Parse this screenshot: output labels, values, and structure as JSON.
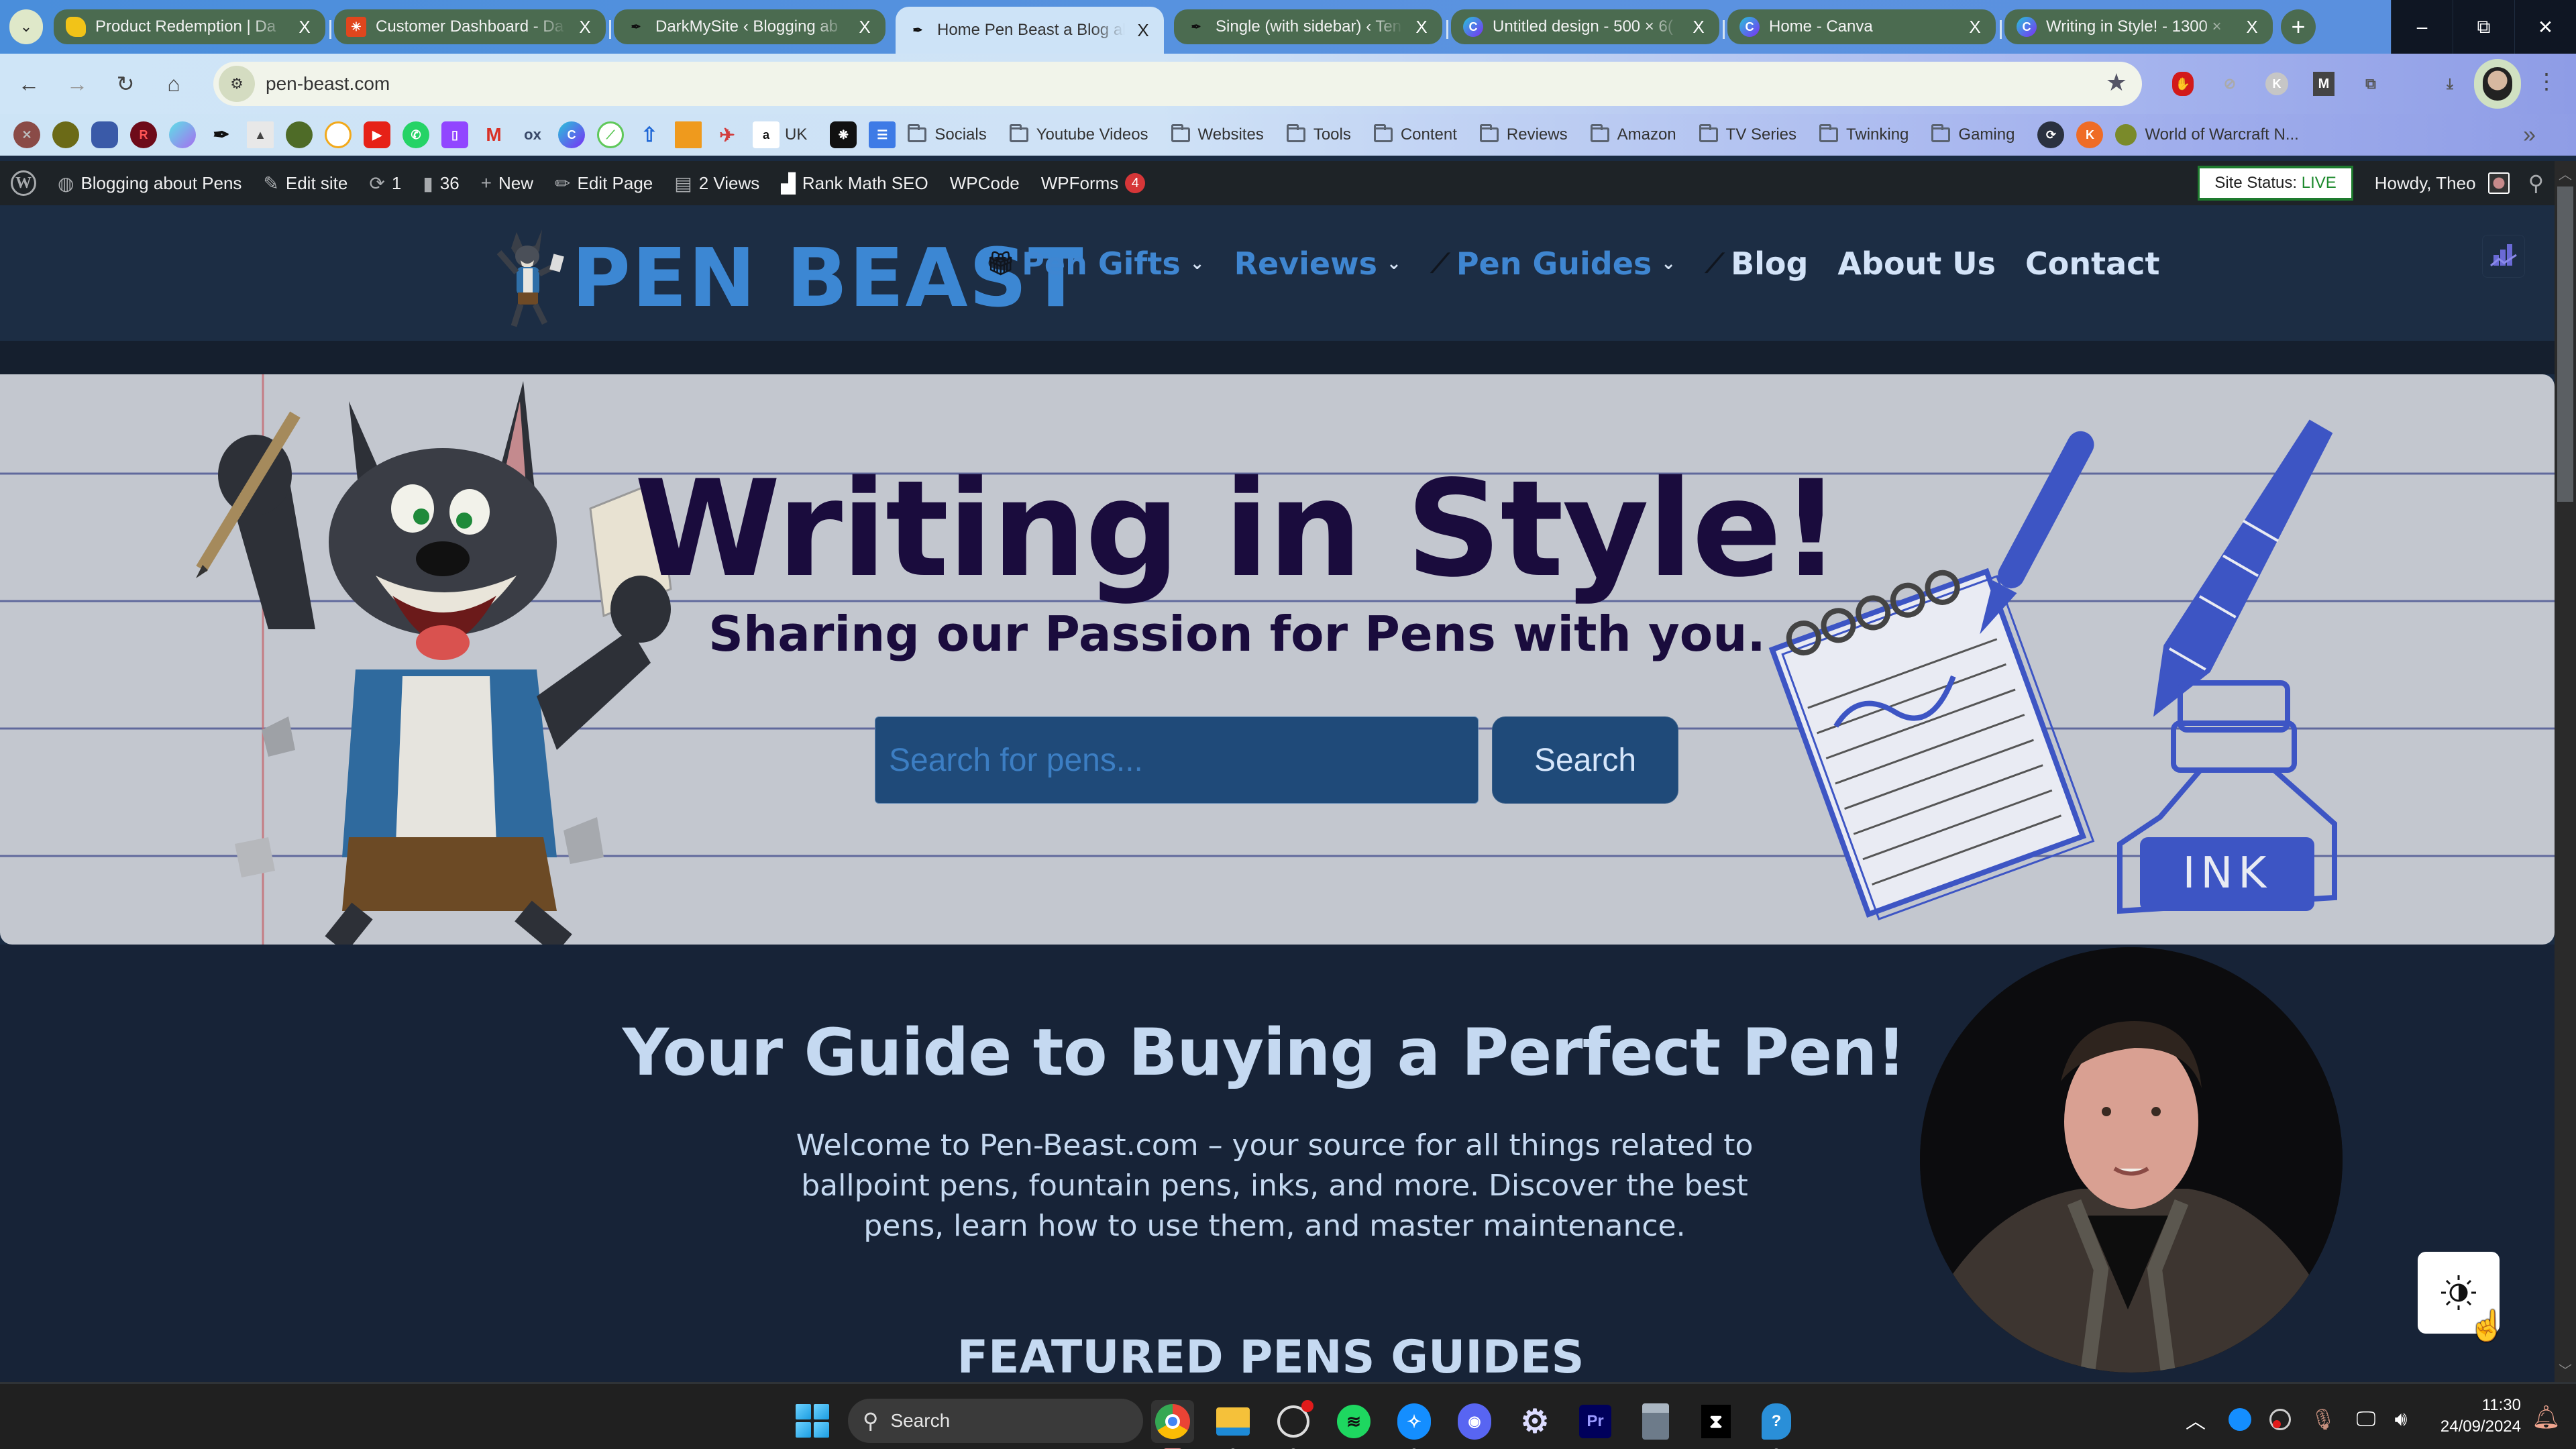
{
  "browser": {
    "tabs": [
      {
        "title": "Product Redemption | Da",
        "favicon": "redemption-icon",
        "active": false
      },
      {
        "title": "Customer Dashboard - Da",
        "favicon": "dashboard-icon",
        "active": false
      },
      {
        "title": "DarkMySite ‹ Blogging ab",
        "favicon": "pen-icon",
        "active": false
      },
      {
        "title": "Home Pen Beast a Blog ab",
        "favicon": "pen-icon",
        "active": true
      },
      {
        "title": "Single (with sidebar) ‹ Ten",
        "favicon": "pen-icon",
        "active": false
      },
      {
        "title": "Untitled design - 500 × 6(",
        "favicon": "canva-icon",
        "active": false
      },
      {
        "title": "Home - Canva",
        "favicon": "canva-icon",
        "active": false
      },
      {
        "title": "Writing in Style! - 1300 ×",
        "favicon": "canva-icon",
        "active": false
      }
    ],
    "tab_close_glyph": "X",
    "new_tab_glyph": "+",
    "window_controls": {
      "minimize": "–",
      "restore": "⧉",
      "close": "✕"
    },
    "url": "pen-beast.com",
    "bookmark_icons": [
      "wow-icon",
      "warcraft-icon",
      "character-icon",
      "r-icon",
      "swirl-icon",
      "pen-icon",
      "wolf-icon",
      "leaf-icon",
      "circle-icon",
      "youtube-icon",
      "whatsapp-icon",
      "twitch-icon",
      "gmail-icon",
      "ox-icon",
      "canva-icon",
      "green-icon",
      "arrow-icon",
      "book-icon",
      "rocket-icon"
    ],
    "amazon_uk_label": "UK",
    "bookmark_folders": [
      "Socials",
      "Youtube Videos",
      "Websites",
      "Tools",
      "Content",
      "Reviews",
      "Amazon",
      "TV Series",
      "Twinking",
      "Gaming"
    ],
    "bookmark_last": "World of Warcraft N...",
    "bookmark_more": "»"
  },
  "admin_bar": {
    "site_name": "Blogging about Pens",
    "edit_site": "Edit site",
    "updates_count": "1",
    "comments_count": "36",
    "new_label": "New",
    "edit_page": "Edit Page",
    "views": "2 Views",
    "rank_math": "Rank Math SEO",
    "wpcode": "WPCode",
    "wpforms": "WPForms",
    "wpforms_badge": "4",
    "site_status_label": "Site Status:",
    "site_status_value": "LIVE",
    "howdy": "Howdy, Theo"
  },
  "site": {
    "logo_text": "PEN BEAST",
    "nav": [
      {
        "label": "Pen Gifts",
        "icon": "gift-icon",
        "has_dropdown": true
      },
      {
        "label": "Reviews",
        "icon": "",
        "has_dropdown": true
      },
      {
        "label": "Pen Guides",
        "icon": "pen-icon",
        "has_dropdown": true
      },
      {
        "label": "Blog",
        "icon": "pen-icon",
        "has_dropdown": false
      },
      {
        "label": "About Us",
        "icon": "",
        "has_dropdown": false
      },
      {
        "label": "Contact",
        "icon": "",
        "has_dropdown": false
      }
    ],
    "hero": {
      "title": "Writing in Style!",
      "subtitle": "Sharing our Passion for Pens with you.",
      "search_placeholder": "Search for pens...",
      "search_button": "Search",
      "ink_label": "INK"
    },
    "guide": {
      "title": "Your Guide to Buying a Perfect Pen!",
      "text": "Welcome to Pen-Beast.com – your source for all things related to ballpoint pens, fountain pens, inks, and more. Discover the best pens, learn how to use them, and master maintenance.",
      "featured_heading": "FEATURED PENS GUIDES"
    }
  },
  "taskbar": {
    "search_label": "Search",
    "apps": [
      "chrome-icon",
      "file-explorer-icon",
      "obs-icon",
      "spotify-icon",
      "battlenet-icon",
      "discord-icon",
      "settings-icon",
      "premiere-icon",
      "calculator-icon",
      "capcut-icon",
      "help-icon"
    ],
    "premiere_label": "Pr",
    "time": "11:30",
    "date": "24/09/2024"
  },
  "colors": {
    "brand_blue": "#3c87d3",
    "hero_text": "#1a0c3d",
    "page_bg": "#172337",
    "admin_bar_bg": "#1e2327",
    "live_green": "#1e8a2e"
  }
}
